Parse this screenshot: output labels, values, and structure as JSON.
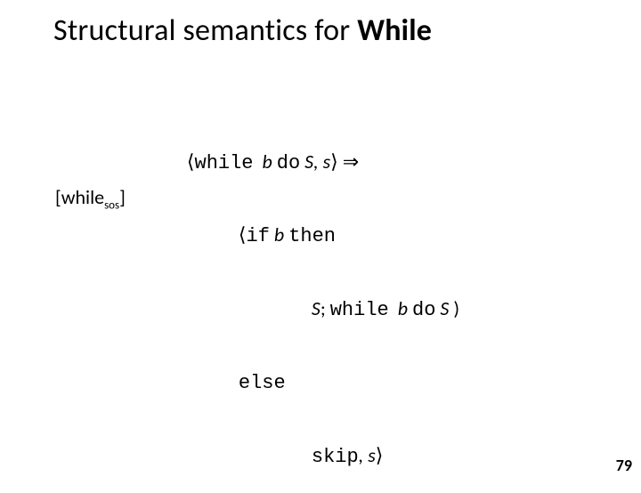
{
  "title": {
    "prefix": "Structural semantics for ",
    "emph": "While"
  },
  "rule": {
    "label_pre": "[while",
    "label_sub": "sos",
    "label_post": "]"
  },
  "body": {
    "l1": {
      "lang": "⟨",
      "kw1": "while",
      "sp1": "  ",
      "b": "b",
      "sp2": " ",
      "kw2": "do",
      "sp3": " ",
      "S": "S",
      "comma": ", ",
      "s": "s",
      "rang": "⟩",
      "arrow": " ⇒"
    },
    "l2": {
      "lang": "⟨",
      "kw": "if",
      "sp": " ",
      "b": "b",
      "sp2": " ",
      "then": "then"
    },
    "l3": {
      "S": "S",
      "semi": "; ",
      "kw": "while",
      "sp": "  ",
      "b": "b",
      "sp2": " ",
      "do": "do",
      "sp3": " ",
      "S2": "S",
      "paren": " )"
    },
    "l4": {
      "else": "else"
    },
    "l5": {
      "skip": "skip",
      "comma": ", ",
      "s": "s",
      "rang": "⟩"
    }
  },
  "page": "79"
}
